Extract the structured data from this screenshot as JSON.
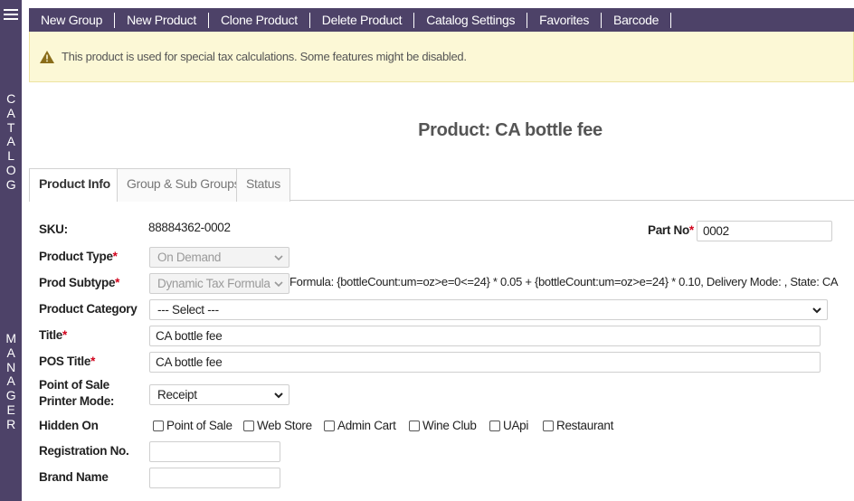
{
  "sidebar": {
    "letters_top": [
      "C",
      "A",
      "T",
      "A",
      "L",
      "O",
      "G"
    ],
    "letters_bottom": [
      "M",
      "A",
      "N",
      "A",
      "G",
      "E",
      "R"
    ]
  },
  "nav": [
    "New Group",
    "New Product",
    "Clone Product",
    "Delete Product",
    "Catalog Settings",
    "Favorites",
    "Barcode"
  ],
  "alert": {
    "icon": "warning-icon",
    "text": "This product is used for special tax calculations. Some features might be disabled."
  },
  "page_title": "Product: CA bottle fee",
  "tabs": [
    "Product Info",
    "Group & Sub Groups",
    "Status"
  ],
  "active_tab": "Product Info",
  "form": {
    "sku_label": "SKU:",
    "sku_value": "88884362-0002",
    "part_no_label": "Part No",
    "part_no_value": "0002",
    "product_type_label": "Product Type",
    "product_type_value": "On Demand",
    "prod_subtype_label": "Prod Subtype",
    "prod_subtype_value": "Dynamic Tax Formula",
    "formula_text": "Formula: {bottleCount:um=oz>e=0<=24} * 0.05 + {bottleCount:um=oz>e=24} * 0.10, Delivery Mode: , State: CA",
    "product_category_label": "Product Category",
    "product_category_value": "--- Select ---",
    "title_label": "Title",
    "title_value": "CA bottle fee",
    "pos_title_label": "POS Title",
    "pos_title_value": "CA bottle fee",
    "printer_mode_label_1": "Point of Sale",
    "printer_mode_label_2": "Printer Mode:",
    "printer_mode_value": "Receipt",
    "hidden_on_label": "Hidden On",
    "hidden_on_options": [
      "Point of Sale",
      "Web Store",
      "Admin Cart",
      "Wine Club",
      "UApi",
      "Restaurant"
    ],
    "registration_label": "Registration No.",
    "registration_value": "",
    "brand_label": "Brand Name",
    "brand_value": ""
  },
  "colors": {
    "header_bg": "#4d4268",
    "alert_bg": "#fcf8d6",
    "required": "#d0021b"
  }
}
